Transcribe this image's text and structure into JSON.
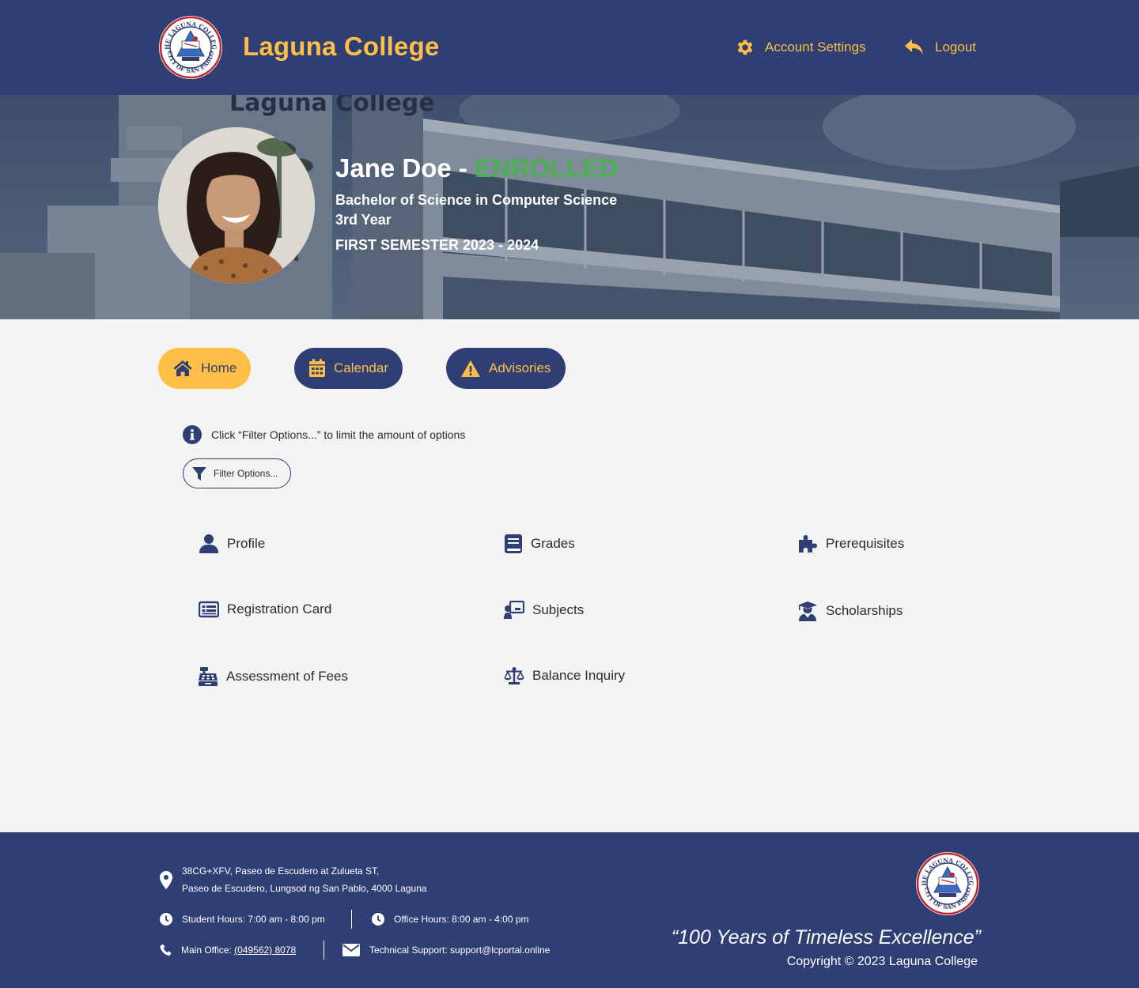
{
  "header": {
    "brand": "Laguna College",
    "account_settings": "Account Settings",
    "logout": "Logout",
    "seal_text_top": "THE LAGUNA COLLEGE",
    "seal_text_bottom": "CITY OF SAN PABLO"
  },
  "hero": {
    "name": "Jane Doe - ",
    "status": "ENROLLED",
    "program": "Bachelor of Science in Computer Science",
    "year": "3rd Year",
    "semester": "FIRST SEMESTER 2023 - 2024",
    "building_sign": "Laguna College"
  },
  "tabs": [
    {
      "label": "Home",
      "icon": "home-icon",
      "active": true
    },
    {
      "label": "Calendar",
      "icon": "calendar-icon",
      "active": false
    },
    {
      "label": "Advisories",
      "icon": "warning-icon",
      "active": false
    }
  ],
  "info": {
    "text": "Click “Filter Options...” to limit the amount of options",
    "filter_button": "Filter Options..."
  },
  "options": [
    {
      "label": "Profile",
      "icon": "user-icon"
    },
    {
      "label": "Grades",
      "icon": "book-icon"
    },
    {
      "label": "Prerequisites",
      "icon": "puzzle-icon"
    },
    {
      "label": "Registration Card",
      "icon": "id-card-icon"
    },
    {
      "label": "Subjects",
      "icon": "teacher-board-icon"
    },
    {
      "label": "Scholarships",
      "icon": "graduate-icon"
    },
    {
      "label": "Assessment of Fees",
      "icon": "cash-register-icon"
    },
    {
      "label": "Balance Inquiry",
      "icon": "scale-icon"
    }
  ],
  "footer": {
    "address_line1": "38CG+XFV, Paseo de Escudero at Zulueta ST,",
    "address_line2": "Paseo de Escudero, Lungsod ng San Pablo, 4000 Laguna",
    "student_hours": "Student Hours: 7:00 am - 8:00 pm",
    "office_hours": "Office Hours: 8:00 am - 4:00 pm",
    "main_office_label": "Main Office: ",
    "main_office_phone": "(049562) 8078",
    "tech_support": "Technical Support: support@lcportal.online",
    "motto": "“100 Years of Timeless Excellence”",
    "copyright": "Copyright © 2023 Laguna College"
  },
  "colors": {
    "navy": "#2f3f73",
    "gold": "#ffbf47",
    "enrolled_green": "#4caf50",
    "background": "#f4f4f5"
  }
}
